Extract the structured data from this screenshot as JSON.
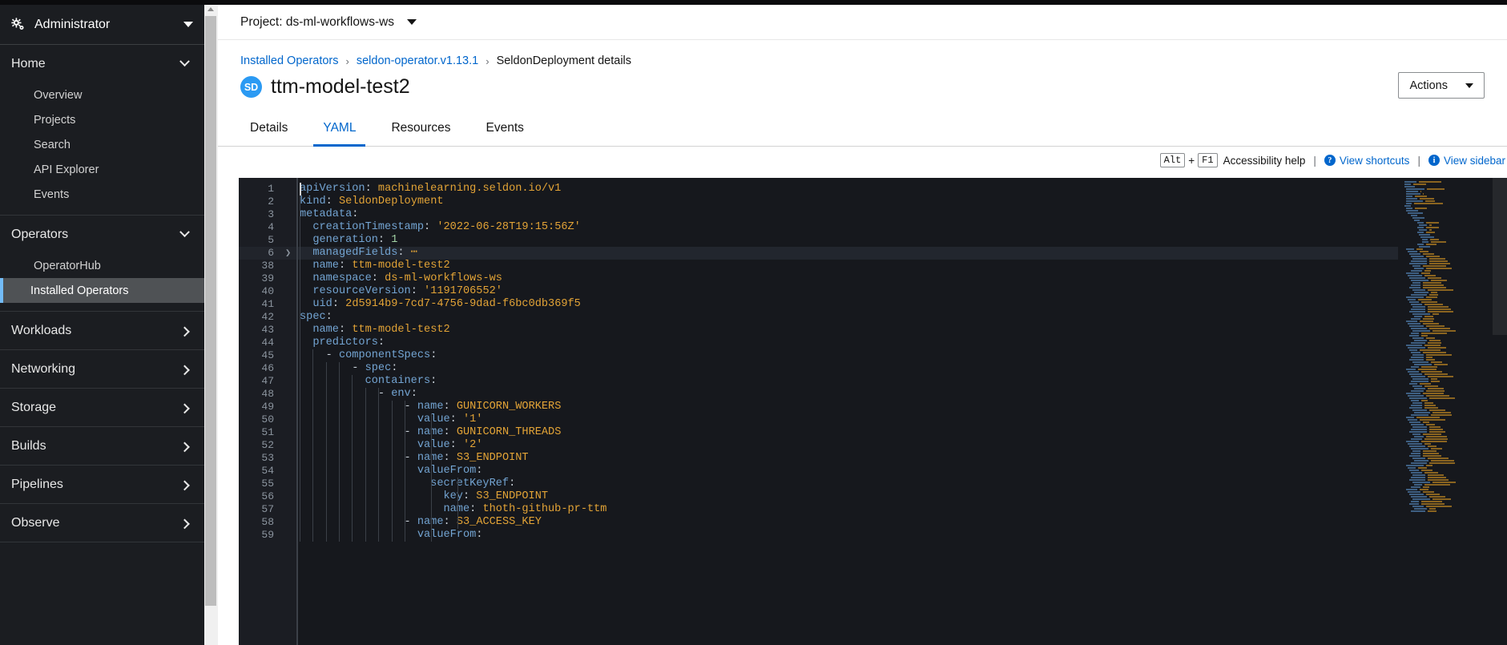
{
  "sidebar": {
    "persona": {
      "label": "Administrator",
      "icon": "gear-icon",
      "caret": "chevron-down-icon"
    },
    "groups": [
      {
        "label": "Home",
        "expanded": true,
        "items": [
          {
            "label": "Overview",
            "active": false
          },
          {
            "label": "Projects",
            "active": false
          },
          {
            "label": "Search",
            "active": false
          },
          {
            "label": "API Explorer",
            "active": false
          },
          {
            "label": "Events",
            "active": false
          }
        ]
      },
      {
        "label": "Operators",
        "expanded": true,
        "items": [
          {
            "label": "OperatorHub",
            "active": false
          },
          {
            "label": "Installed Operators",
            "active": true
          }
        ]
      },
      {
        "label": "Workloads",
        "expanded": false,
        "items": []
      },
      {
        "label": "Networking",
        "expanded": false,
        "items": []
      },
      {
        "label": "Storage",
        "expanded": false,
        "items": []
      },
      {
        "label": "Builds",
        "expanded": false,
        "items": []
      },
      {
        "label": "Pipelines",
        "expanded": false,
        "items": []
      },
      {
        "label": "Observe",
        "expanded": false,
        "items": []
      }
    ]
  },
  "project_selector": {
    "label": "Project: ds-ml-workflows-ws",
    "caret": "caret-down-icon"
  },
  "breadcrumb": {
    "items": [
      {
        "label": "Installed Operators",
        "link": true
      },
      {
        "label": "seldon-operator.v1.13.1",
        "link": true
      },
      {
        "label": "SeldonDeployment details",
        "link": false
      }
    ],
    "separator": "›"
  },
  "header": {
    "badge": "SD",
    "title": "ttm-model-test2",
    "actions_label": "Actions"
  },
  "tabs": [
    {
      "label": "Details",
      "active": false
    },
    {
      "label": "YAML",
      "active": true
    },
    {
      "label": "Resources",
      "active": false
    },
    {
      "label": "Events",
      "active": false
    }
  ],
  "a11y": {
    "key1": "Alt",
    "plus": "+",
    "key2": "F1",
    "help_label": "Accessibility help",
    "divider": "|",
    "shortcuts_label": "View shortcuts",
    "shortcuts_icon_glyph": "?",
    "sidebar_label": "View sidebar",
    "sidebar_icon_glyph": "i"
  },
  "editor": {
    "language": "yaml",
    "accent_color": "#06c",
    "background": "#16181d",
    "gutter_background": "#1b1d23",
    "key_color": "#73a4d2",
    "value_color": "#e2a336",
    "number_color": "#a5d6a7",
    "highlighted_line": 6,
    "folded_line": 6,
    "lines": [
      {
        "num": "1",
        "indent": 0,
        "text": "apiVersion: machinelearning.seldon.io/v1",
        "key": "apiVersion",
        "value": "machinelearning.seldon.io/v1"
      },
      {
        "num": "2",
        "indent": 0,
        "text": "kind: SeldonDeployment",
        "key": "kind",
        "value": "SeldonDeployment"
      },
      {
        "num": "3",
        "indent": 0,
        "text": "metadata:",
        "key": "metadata",
        "value": ""
      },
      {
        "num": "4",
        "indent": 1,
        "text": "creationTimestamp: '2022-06-28T19:15:56Z'",
        "key": "creationTimestamp",
        "value": "'2022-06-28T19:15:56Z'"
      },
      {
        "num": "5",
        "indent": 1,
        "text": "generation: 1",
        "key": "generation",
        "value": "1"
      },
      {
        "num": "6",
        "indent": 1,
        "text": "managedFields: ⋯",
        "key": "managedFields",
        "value": "⋯",
        "folded": true
      },
      {
        "num": "38",
        "indent": 1,
        "text": "name: ttm-model-test2",
        "key": "name",
        "value": "ttm-model-test2"
      },
      {
        "num": "39",
        "indent": 1,
        "text": "namespace: ds-ml-workflows-ws",
        "key": "namespace",
        "value": "ds-ml-workflows-ws"
      },
      {
        "num": "40",
        "indent": 1,
        "text": "resourceVersion: '1191706552'",
        "key": "resourceVersion",
        "value": "'1191706552'"
      },
      {
        "num": "41",
        "indent": 1,
        "text": "uid: 2d5914b9-7cd7-4756-9dad-f6bc0db369f5",
        "key": "uid",
        "value": "2d5914b9-7cd7-4756-9dad-f6bc0db369f5"
      },
      {
        "num": "42",
        "indent": 0,
        "text": "spec:",
        "key": "spec",
        "value": ""
      },
      {
        "num": "43",
        "indent": 1,
        "text": "name: ttm-model-test2",
        "key": "name",
        "value": "ttm-model-test2"
      },
      {
        "num": "44",
        "indent": 1,
        "text": "predictors:",
        "key": "predictors",
        "value": ""
      },
      {
        "num": "45",
        "indent": 2,
        "text": "- componentSpecs:",
        "key": "componentSpecs",
        "value": "",
        "dash": true
      },
      {
        "num": "46",
        "indent": 4,
        "text": "- spec:",
        "key": "spec",
        "value": "",
        "dash": true
      },
      {
        "num": "47",
        "indent": 5,
        "text": "containers:",
        "key": "containers",
        "value": ""
      },
      {
        "num": "48",
        "indent": 6,
        "text": "- env:",
        "key": "env",
        "value": "",
        "dash": true
      },
      {
        "num": "49",
        "indent": 8,
        "text": "- name: GUNICORN_WORKERS",
        "key": "name",
        "value": "GUNICORN_WORKERS",
        "dash": true
      },
      {
        "num": "50",
        "indent": 9,
        "text": "value: '1'",
        "key": "value",
        "value": "'1'"
      },
      {
        "num": "51",
        "indent": 8,
        "text": "- name: GUNICORN_THREADS",
        "key": "name",
        "value": "GUNICORN_THREADS",
        "dash": true
      },
      {
        "num": "52",
        "indent": 9,
        "text": "value: '2'",
        "key": "value",
        "value": "'2'"
      },
      {
        "num": "53",
        "indent": 8,
        "text": "- name: S3_ENDPOINT",
        "key": "name",
        "value": "S3_ENDPOINT",
        "dash": true
      },
      {
        "num": "54",
        "indent": 9,
        "text": "valueFrom:",
        "key": "valueFrom",
        "value": ""
      },
      {
        "num": "55",
        "indent": 10,
        "text": "secretKeyRef:",
        "key": "secretKeyRef",
        "value": ""
      },
      {
        "num": "56",
        "indent": 11,
        "text": "key: S3_ENDPOINT",
        "key": "key",
        "value": "S3_ENDPOINT"
      },
      {
        "num": "57",
        "indent": 11,
        "text": "name: thoth-github-pr-ttm",
        "key": "name",
        "value": "thoth-github-pr-ttm"
      },
      {
        "num": "58",
        "indent": 8,
        "text": "- name: S3_ACCESS_KEY",
        "key": "name",
        "value": "S3_ACCESS_KEY",
        "dash": true
      },
      {
        "num": "59",
        "indent": 9,
        "text": "valueFrom:",
        "key": "valueFrom",
        "value": ""
      }
    ]
  }
}
